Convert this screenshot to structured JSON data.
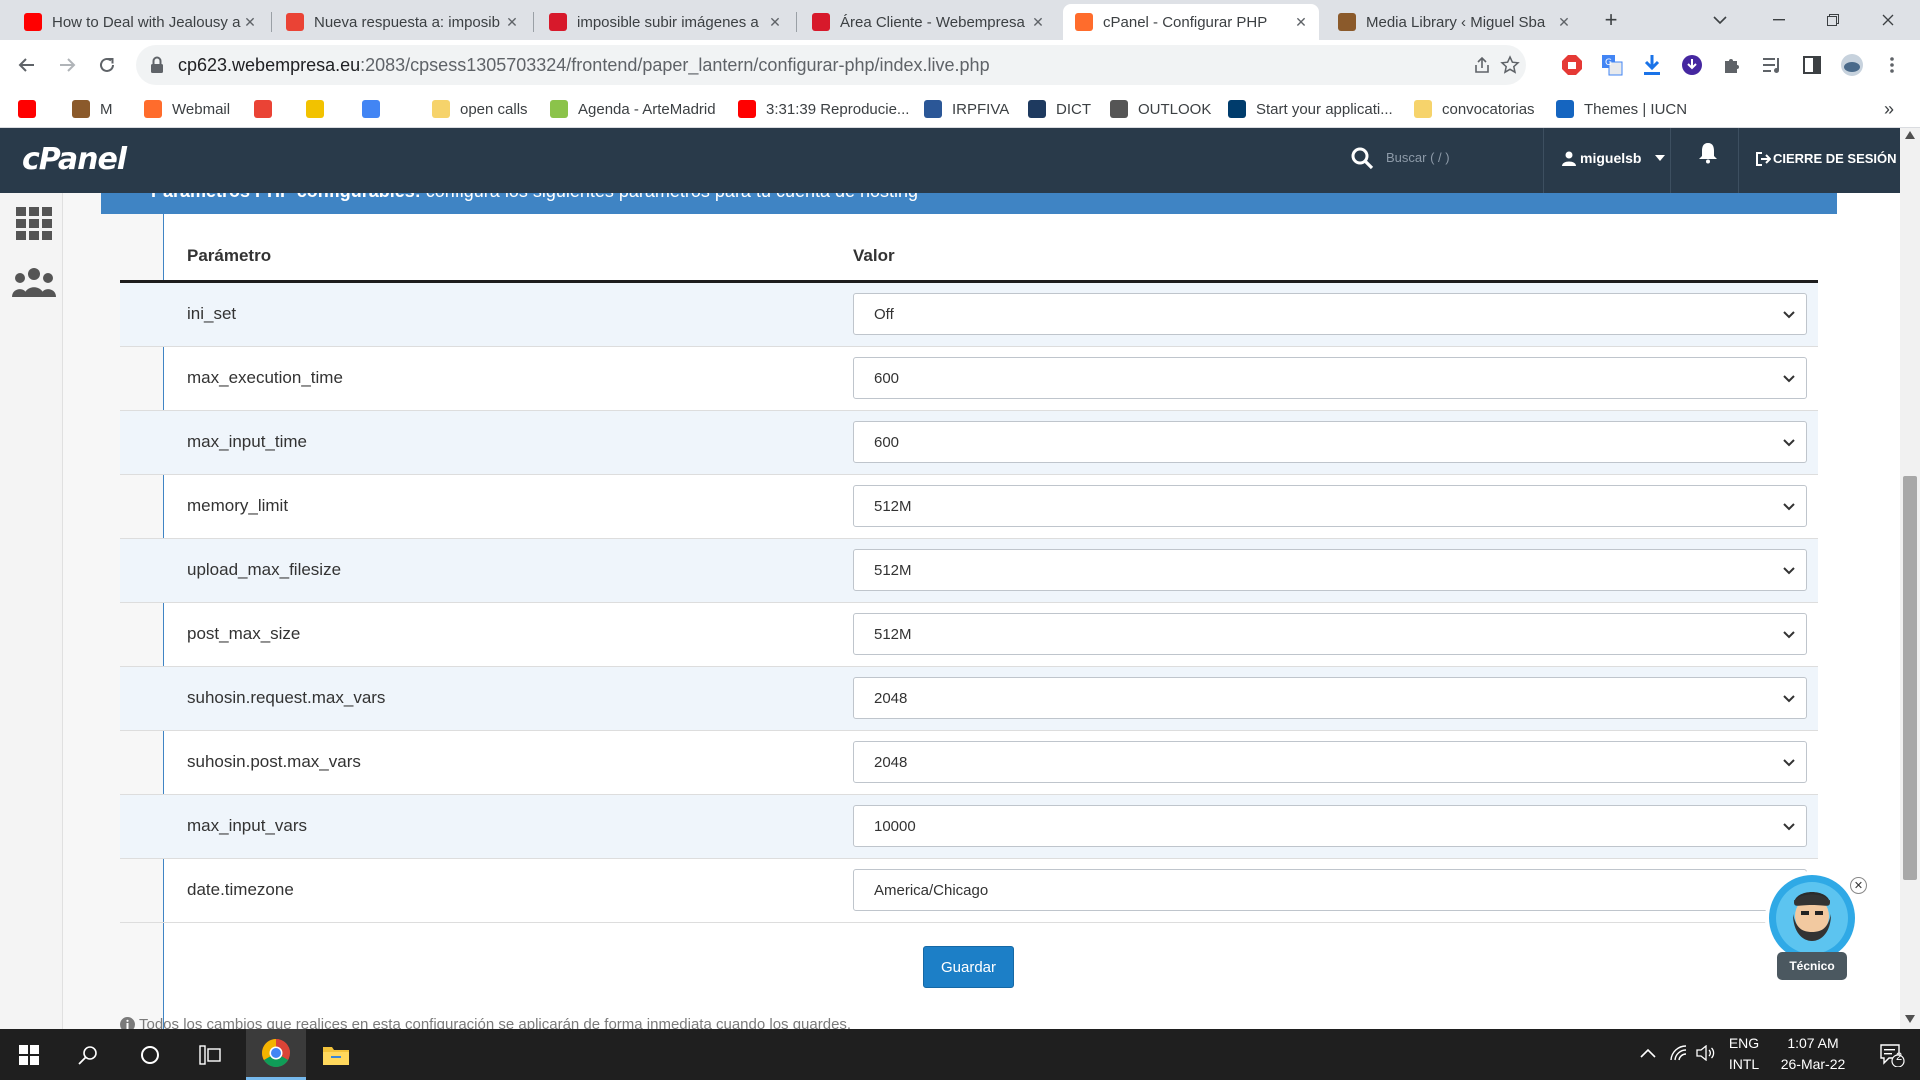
{
  "browser": {
    "tabs": [
      {
        "title": "How to Deal with Jealousy a",
        "favicon": "youtube-icon",
        "color": "#ff0000"
      },
      {
        "title": "Nueva respuesta a: imposib",
        "favicon": "gmail-icon",
        "color": "#ea4335"
      },
      {
        "title": "imposible subir imágenes a",
        "favicon": "webempresa-icon",
        "color": "#d7192b"
      },
      {
        "title": "Área Cliente - Webempresa",
        "favicon": "webempresa-w-icon",
        "color": "#d7192b"
      },
      {
        "title": "cPanel - Configurar PHP",
        "favicon": "cpanel-icon",
        "color": "#ff6c2c",
        "active": true
      },
      {
        "title": "Media Library ‹ Miguel Sba",
        "favicon": "cookie-icon",
        "color": "#8b5a2b"
      }
    ],
    "new_tab": "+",
    "url_host": "cp623.webempresa.eu",
    "url_path": ":2083/cpsess1305703324/frontend/paper_lantern/configurar-php/index.live.php",
    "bookmarks": [
      {
        "label": "",
        "icon": "youtube-icon",
        "color": "#ff0000"
      },
      {
        "label": "M",
        "icon": "cookie-icon",
        "color": "#8b5a2b"
      },
      {
        "label": "Webmail",
        "icon": "cpanel-icon",
        "color": "#ff6c2c"
      },
      {
        "label": "",
        "icon": "gmail-icon",
        "color": "#ea4335"
      },
      {
        "label": "",
        "icon": "euro-icon",
        "color": "#f2c200"
      },
      {
        "label": "",
        "icon": "google-icon",
        "color": "#4285f4"
      },
      {
        "label": "open calls",
        "icon": "folder-icon",
        "color": "#f6d36b"
      },
      {
        "label": "Agenda - ArteMadrid",
        "icon": "page-icon",
        "color": "#8bc34a"
      },
      {
        "label": "3:31:39 Reproducie...",
        "icon": "youtube-icon",
        "color": "#ff0000"
      },
      {
        "label": "IRPFIVA",
        "icon": "ds-icon",
        "color": "#2b5797"
      },
      {
        "label": "DICT",
        "icon": "dict-icon",
        "color": "#1e3a5f"
      },
      {
        "label": "OUTLOOK",
        "icon": "globe-icon",
        "color": "#555555"
      },
      {
        "label": "Start your applicati...",
        "icon": "ucsc-icon",
        "color": "#003c6c"
      },
      {
        "label": "convocatorias",
        "icon": "folder-icon",
        "color": "#f6d36b"
      },
      {
        "label": "Themes | IUCN",
        "icon": "iucn-icon",
        "color": "#1565c0"
      }
    ],
    "bookmarks_more": "»"
  },
  "cpanel": {
    "logo": "cPanel",
    "search_placeholder": "Buscar ( / )",
    "username": "miguelsb",
    "logout": "CIERRE DE SESIÓN",
    "section_title_bold": "Parámetros PHP configurables:",
    "section_title_rest": " configura los siguientes parámetros para tu cuenta de hosting",
    "col_param": "Parámetro",
    "col_value": "Valor",
    "params": [
      {
        "name": "ini_set",
        "value": "Off",
        "type": "select"
      },
      {
        "name": "max_execution_time",
        "value": "600",
        "type": "select"
      },
      {
        "name": "max_input_time",
        "value": "600",
        "type": "select"
      },
      {
        "name": "memory_limit",
        "value": "512M",
        "type": "select"
      },
      {
        "name": "upload_max_filesize",
        "value": "512M",
        "type": "select"
      },
      {
        "name": "post_max_size",
        "value": "512M",
        "type": "select"
      },
      {
        "name": "suhosin.request.max_vars",
        "value": "2048",
        "type": "select"
      },
      {
        "name": "suhosin.post.max_vars",
        "value": "2048",
        "type": "select"
      },
      {
        "name": "max_input_vars",
        "value": "10000",
        "type": "select"
      },
      {
        "name": "date.timezone",
        "value": "America/Chicago",
        "type": "text"
      }
    ],
    "save_label": "Guardar",
    "note": "Todos los cambios que realices en esta configuración se aplicarán de forma inmediata cuando los guardes.",
    "bot_label": "Técnico"
  },
  "taskbar": {
    "lang_top": "ENG",
    "lang_bottom": "INTL",
    "time": "1:07 AM",
    "date": "26-Mar-22",
    "notif_count": "2"
  },
  "colors": {
    "cpanel_header": "#293a4a",
    "panel_blue": "#3f84c4",
    "save_button": "#1c7fc7",
    "row_alt": "#eff5fb"
  }
}
